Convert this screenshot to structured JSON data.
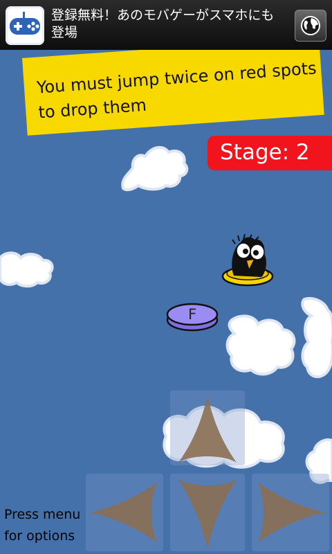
{
  "ad": {
    "text": "登録無料！あのモバゲーがスマホにも登場",
    "logo_icon": "gamepad-icon",
    "globe_icon": "globe-icon"
  },
  "game": {
    "hint": "You must jump twice on red spots to drop them",
    "stage_label": "Stage: 2",
    "platform_label": "F",
    "menu_hint": "Press menu for options"
  },
  "colors": {
    "sky": "#4571ab",
    "banner": "#f7d900",
    "stage_badge": "#f2141c",
    "platform_purple": "#9a8cf2",
    "platform_yellow": "#f5d400",
    "dpad_arrow": "#8a6f52"
  },
  "controls": {
    "up_icon": "arrow-up-icon",
    "down_icon": "arrow-down-icon",
    "left_icon": "arrow-left-icon",
    "right_icon": "arrow-right-icon"
  }
}
